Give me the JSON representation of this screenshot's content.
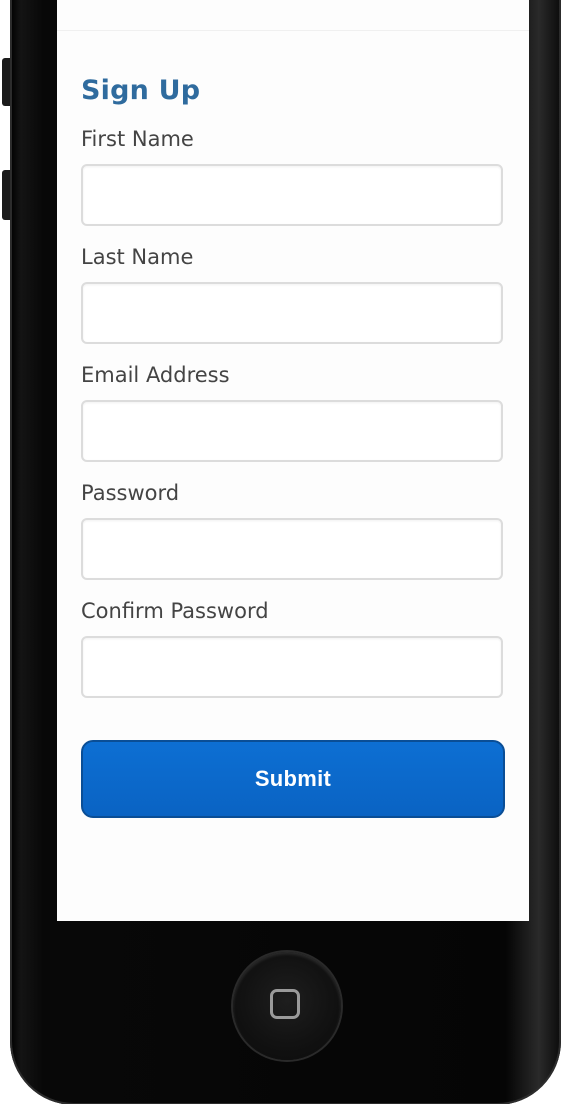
{
  "form": {
    "title": "Sign Up",
    "fields": [
      {
        "label": "First Name",
        "value": ""
      },
      {
        "label": "Last Name",
        "value": ""
      },
      {
        "label": "Email Address",
        "value": ""
      },
      {
        "label": "Password",
        "value": ""
      },
      {
        "label": "Confirm Password",
        "value": ""
      }
    ],
    "submit_label": "Submit"
  },
  "colors": {
    "title": "#2f6b9e",
    "submit_bg": "#0a63c3",
    "submit_text": "#ffffff",
    "device_body": "#050505"
  },
  "icons": {
    "home": "home-button-icon"
  }
}
